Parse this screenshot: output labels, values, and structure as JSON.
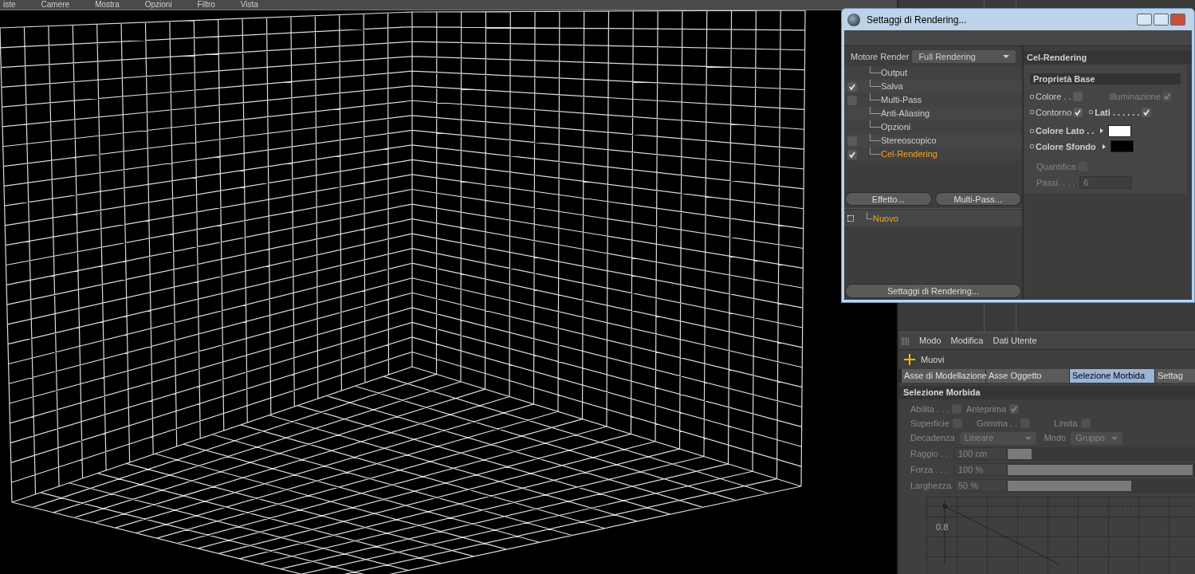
{
  "menu_bar": [
    "iste",
    "Camere",
    "Mostra",
    "Opzioni",
    "Filtro",
    "Vista"
  ],
  "dialog": {
    "title": "Settaggi di Rendering...",
    "engine": {
      "label": "Motore Render",
      "value": "Full Rendering"
    },
    "tree": [
      {
        "label": "Output",
        "kind": "plain",
        "selected": false
      },
      {
        "label": "Salva",
        "kind": "checkbox",
        "checked": true,
        "selected": false
      },
      {
        "label": "Multi-Pass",
        "kind": "checkbox",
        "checked": false,
        "selected": false
      },
      {
        "label": "Anti-Aliasing",
        "kind": "plain",
        "selected": false
      },
      {
        "label": "Opzioni",
        "kind": "plain",
        "selected": false
      },
      {
        "label": "Stereoscopico",
        "kind": "checkbox",
        "checked": false,
        "selected": false
      },
      {
        "label": "Cel-Rendering",
        "kind": "checkbox",
        "checked": true,
        "selected": true
      }
    ],
    "buttons": [
      "Effetto...",
      "Multi-Pass..."
    ],
    "presets": [
      {
        "label": "Nuovo",
        "selected": true
      }
    ],
    "bottom_button": "Settaggi di Rendering...",
    "panel_title": "Cel-Rendering",
    "group_title": "Proprietà Base",
    "props": [
      {
        "kind": "check",
        "label": "Colore",
        "dots": " . .",
        "checked": false,
        "disabled": false,
        "bold": false
      },
      {
        "kind": "check",
        "label": "Illuminazione",
        "checked": true,
        "disabled": true,
        "bold": false
      },
      {
        "kind": "check",
        "label": "Contorno",
        "checked": true,
        "disabled": false,
        "bold": false
      },
      {
        "kind": "check",
        "label": "Lati",
        "dots": " . . . . . .",
        "checked": true,
        "disabled": false,
        "bold": true
      },
      {
        "kind": "color",
        "label": "Colore Lato",
        "dots": " . .",
        "color": "#ffffff",
        "disabled": false,
        "bold": true
      },
      {
        "kind": "color",
        "label": "Colore Sfondo",
        "color": "#000000",
        "disabled": false,
        "bold": true
      },
      {
        "kind": "check",
        "label": "Quantifica",
        "checked": false,
        "disabled": true,
        "bold": false
      },
      {
        "kind": "number",
        "label": "Passi",
        "dots": ". . . .",
        "value": "6",
        "disabled": true,
        "bold": false
      }
    ]
  },
  "attributes": {
    "menu": [
      "Modo",
      "Modifica",
      "Dati Utente"
    ],
    "tool": "Muovi",
    "tabs": [
      {
        "label": "Asse di Modellazione",
        "selected": false
      },
      {
        "label": "Asse Oggetto",
        "selected": false
      },
      {
        "label": "Selezione Morbida",
        "selected": true
      },
      {
        "label": "Settag",
        "selected": false
      }
    ],
    "section": "Selezione Morbida",
    "checks": [
      {
        "label": "Abilita . . .",
        "checked": false
      },
      {
        "label": "Anteprima",
        "checked": true
      },
      {
        "label": "Superficie",
        "checked": false
      },
      {
        "label": "Gomma . .",
        "checked": false
      },
      {
        "label": "Limita",
        "checked": false
      }
    ],
    "dropdowns": [
      {
        "label": "Decadenza",
        "value": "Lineare"
      },
      {
        "label": "Modo",
        "value": "Gruppo"
      }
    ],
    "sliders": [
      {
        "label": "Raggio . .",
        "value": "100 cm",
        "level": 0.13
      },
      {
        "label": "Forza . . .",
        "value": "100 %",
        "level": 1
      },
      {
        "label": "Larghezza",
        "value": "50 %",
        "level": 0.67
      }
    ],
    "curve": {
      "tick_label": "0.8"
    }
  }
}
